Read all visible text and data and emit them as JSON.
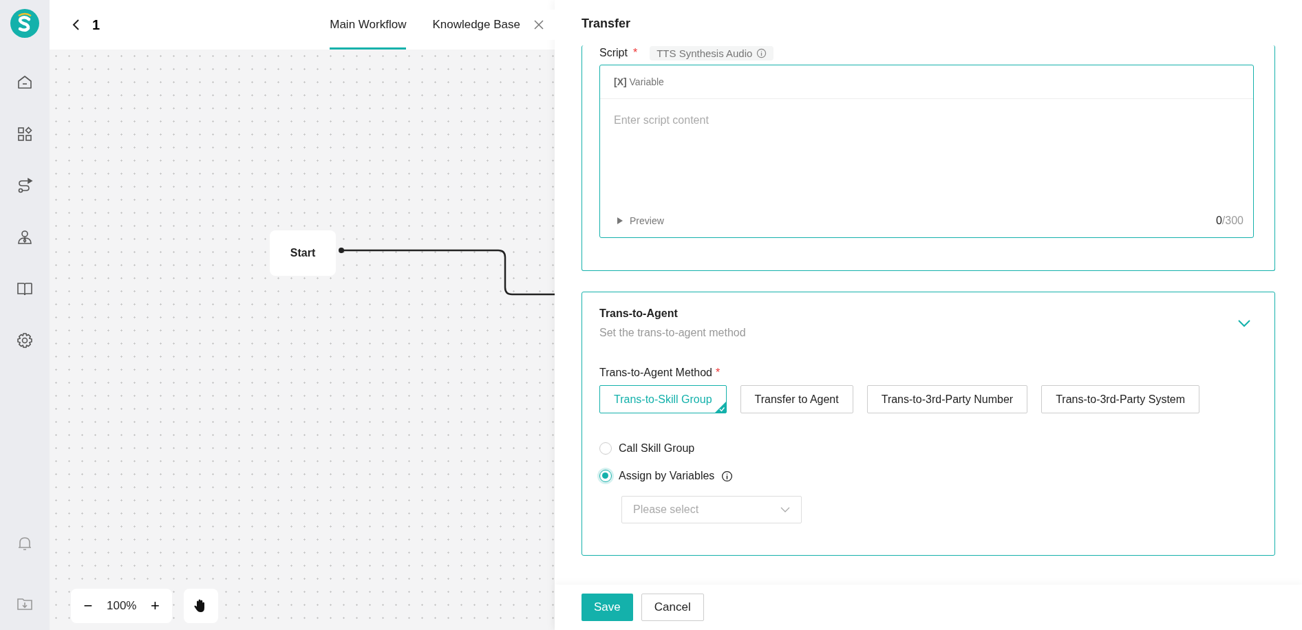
{
  "header": {
    "back_label": "1",
    "tabs": [
      {
        "label": "Main Workflow",
        "selected": true
      },
      {
        "label": "Knowledge Base",
        "selected": false
      }
    ]
  },
  "canvas": {
    "node": {
      "label": "Start"
    },
    "zoom": "100%",
    "zoom_out": "−",
    "zoom_in": "+"
  },
  "panel": {
    "title": "Transfer",
    "script": {
      "label": "Script",
      "required": true,
      "required_mark": "*",
      "tag": "TTS Synthesis Audio",
      "variable_mark": "[X]",
      "variable_label": "Variable",
      "placeholder": "Enter script content",
      "preview": "Preview",
      "count": "0",
      "max": "/300"
    },
    "agent": {
      "title": "Trans-to-Agent",
      "subtitle": "Set the trans-to-agent method",
      "expanded": true,
      "method_label": "Trans-to-Agent Method",
      "required": true,
      "required_mark": "*",
      "methods": [
        {
          "label": "Trans-to-Skill Group",
          "selected": true
        },
        {
          "label": "Transfer to Agent",
          "selected": false
        },
        {
          "label": "Trans-to-3rd-Party Number",
          "selected": false
        },
        {
          "label": "Trans-to-3rd-Party System",
          "selected": false
        }
      ],
      "options": [
        {
          "label": "Call Skill Group",
          "selected": false,
          "info": false
        },
        {
          "label": "Assign by Variables",
          "selected": true,
          "info": true
        }
      ],
      "select_placeholder": "Please select"
    },
    "buttons": [
      {
        "label": "Save",
        "kind": "primary"
      },
      {
        "label": "Cancel",
        "kind": "default"
      }
    ]
  }
}
